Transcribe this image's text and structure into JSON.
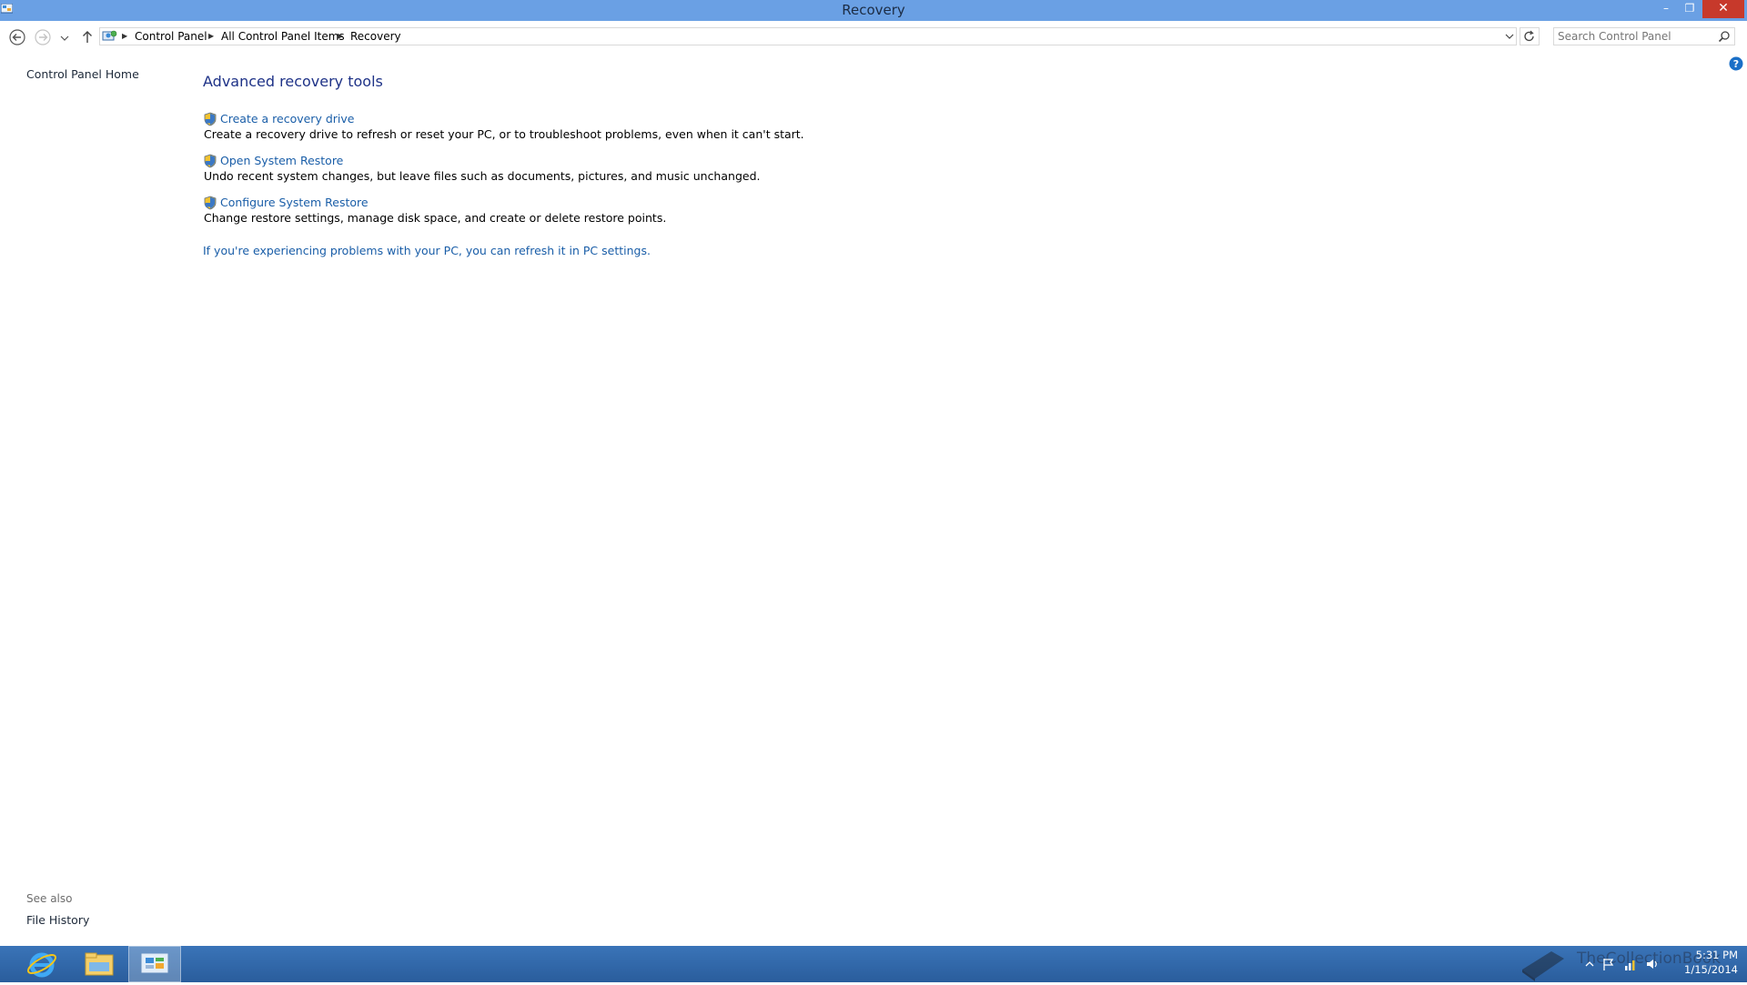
{
  "window": {
    "title": "Recovery"
  },
  "window_controls": {
    "minimize": "–",
    "maximize": "❐",
    "close": "✕"
  },
  "address_bar": {
    "breadcrumbs": [
      "Control Panel",
      "All Control Panel Items",
      "Recovery"
    ],
    "separator": "▶"
  },
  "search": {
    "placeholder": "Search Control Panel"
  },
  "left_nav": {
    "home_link": "Control Panel Home",
    "see_also_label": "See also",
    "see_also_items": [
      "File History"
    ]
  },
  "main": {
    "heading": "Advanced recovery tools",
    "tools": [
      {
        "label": "Create a recovery drive",
        "description": "Create a recovery drive to refresh or reset your PC, or to troubleshoot problems, even when it can't start."
      },
      {
        "label": "Open System Restore",
        "description": "Undo recent system changes, but leave files such as documents, pictures, and music unchanged."
      },
      {
        "label": "Configure System Restore",
        "description": "Change restore settings, manage disk space, and create or delete restore points."
      }
    ],
    "refresh_link": "If you're experiencing problems with your PC, you can refresh it in PC settings."
  },
  "taskbar": {
    "apps": [
      "internet-explorer",
      "file-explorer",
      "control-panel"
    ],
    "watermark": "TheCollectionBook",
    "clock": {
      "time": "5:31 PM",
      "date": "1/15/2014"
    }
  },
  "colors": {
    "titlebar": "#6aa0e4",
    "link": "#1a5ea8",
    "heading": "#1e3287",
    "close_button": "#c7392b",
    "taskbar": "#2f66a8"
  }
}
